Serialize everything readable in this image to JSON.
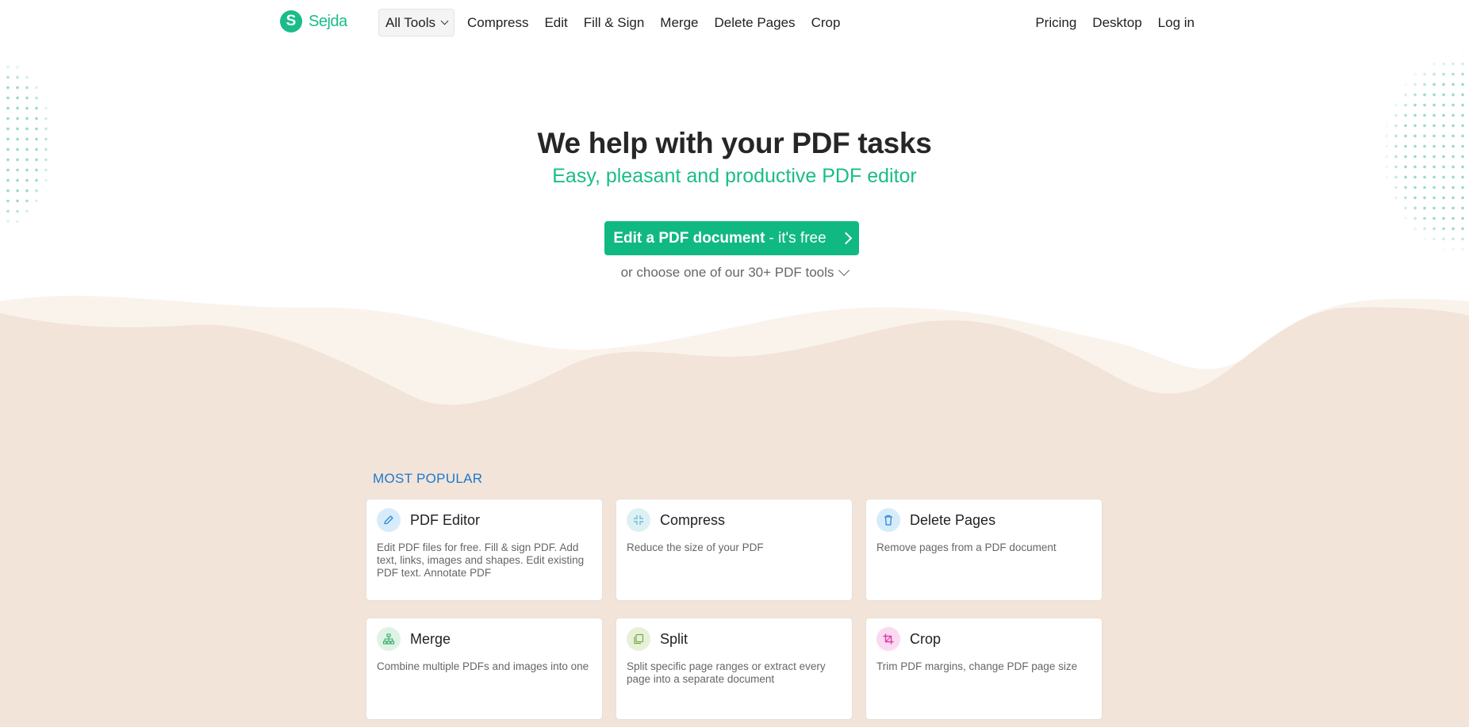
{
  "brand": {
    "logo_letter": "S",
    "name": "Sejda",
    "color": "#1abc8a"
  },
  "nav": {
    "dropdown_label": "All Tools",
    "links": [
      "Compress",
      "Edit",
      "Fill & Sign",
      "Merge",
      "Delete Pages",
      "Crop"
    ],
    "right_links": [
      "Pricing",
      "Desktop",
      "Log in"
    ]
  },
  "hero": {
    "title": "We help with your PDF tasks",
    "subtitle": "Easy, pleasant and productive PDF editor",
    "cta_strong": "Edit a PDF document",
    "cta_light": " - it's free",
    "more_tools": "or choose one of our 30+ PDF tools",
    "cta_color": "#10b981"
  },
  "popular": {
    "heading": "MOST POPULAR",
    "cards": [
      {
        "title": "PDF Editor",
        "desc": "Edit PDF files for free. Fill & sign PDF. Add text, links, images and shapes. Edit existing PDF text. Annotate PDF",
        "icon": "pencil-icon"
      },
      {
        "title": "Compress",
        "desc": "Reduce the size of your PDF",
        "icon": "compress-icon"
      },
      {
        "title": "Delete Pages",
        "desc": "Remove pages from a PDF document",
        "icon": "trash-icon"
      },
      {
        "title": "Merge",
        "desc": "Combine multiple PDFs and images into one",
        "icon": "merge-icon"
      },
      {
        "title": "Split",
        "desc": "Split specific page ranges or extract every page into a separate document",
        "icon": "split-icon"
      },
      {
        "title": "Crop",
        "desc": "Trim PDF margins, change PDF page size",
        "icon": "crop-icon"
      }
    ]
  }
}
